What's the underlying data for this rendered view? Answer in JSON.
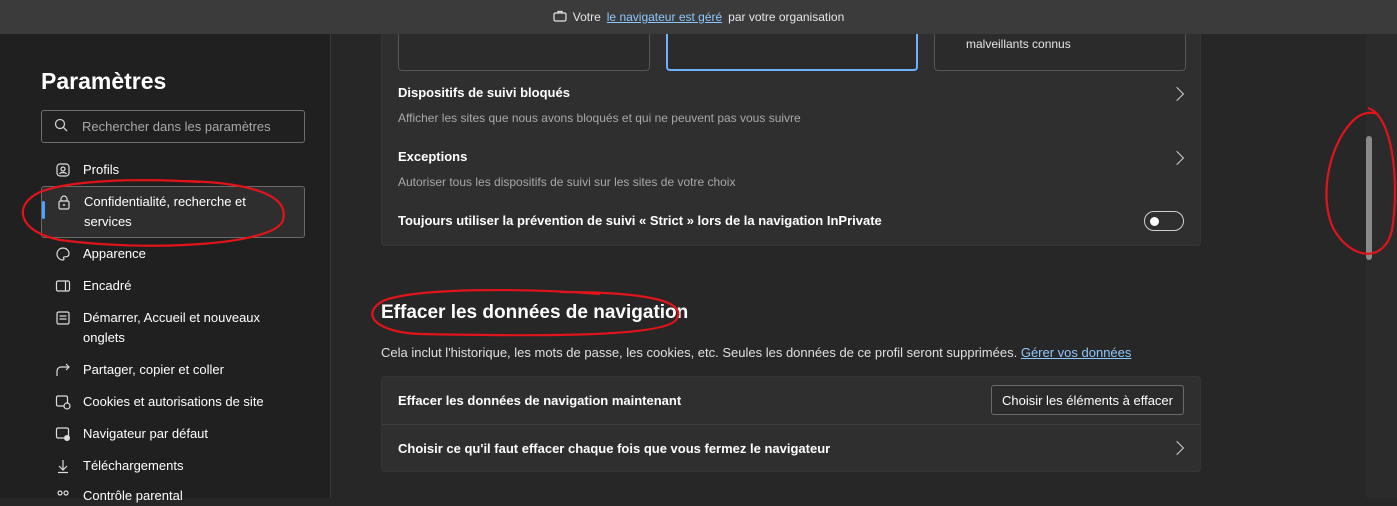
{
  "infobar": {
    "prefix": "Votre",
    "link": "le navigateur est géré",
    "suffix": "par votre organisation"
  },
  "sidebar": {
    "title": "Paramètres",
    "search_placeholder": "Rechercher dans les paramètres",
    "items": [
      {
        "label": "Profils",
        "icon": "profile-icon"
      },
      {
        "label": "Confidentialité, recherche et services",
        "icon": "lock-icon",
        "active": true
      },
      {
        "label": "Apparence",
        "icon": "palette-icon"
      },
      {
        "label": "Encadré",
        "icon": "sidebar-panel-icon"
      },
      {
        "label": "Démarrer, Accueil et nouveaux onglets",
        "icon": "home-icon"
      },
      {
        "label": "Partager, copier et coller",
        "icon": "share-icon"
      },
      {
        "label": "Cookies et autorisations de site",
        "icon": "cookie-settings-icon"
      },
      {
        "label": "Navigateur par défaut",
        "icon": "default-browser-icon"
      },
      {
        "label": "Téléchargements",
        "icon": "download-icon"
      },
      {
        "label": "Contrôle parental",
        "icon": "family-icon"
      }
    ]
  },
  "tracking": {
    "tile3_text": "malveillants connus",
    "blocked_title": "Dispositifs de suivi bloqués",
    "blocked_desc": "Afficher les sites que nous avons bloqués et qui ne peuvent pas vous suivre",
    "exceptions_title": "Exceptions",
    "exceptions_desc": "Autoriser tous les dispositifs de suivi sur les sites de votre choix",
    "strict_label": "Toujours utiliser la prévention de suivi « Strict » lors de la navigation InPrivate",
    "strict_enabled": false
  },
  "clear_data": {
    "title": "Effacer les données de navigation",
    "desc": "Cela inclut l'historique, les mots de passe, les cookies, etc. Seules les données de ce profil seront supprimées.",
    "desc_link": "Gérer vos données",
    "now_label": "Effacer les données de navigation maintenant",
    "choose_button": "Choisir les éléments à effacer",
    "on_close_label": "Choisir ce qu'il faut effacer chaque fois que vous fermez le navigateur"
  },
  "colors": {
    "accent": "#4aa3ff",
    "annotation": "#e0141a"
  }
}
